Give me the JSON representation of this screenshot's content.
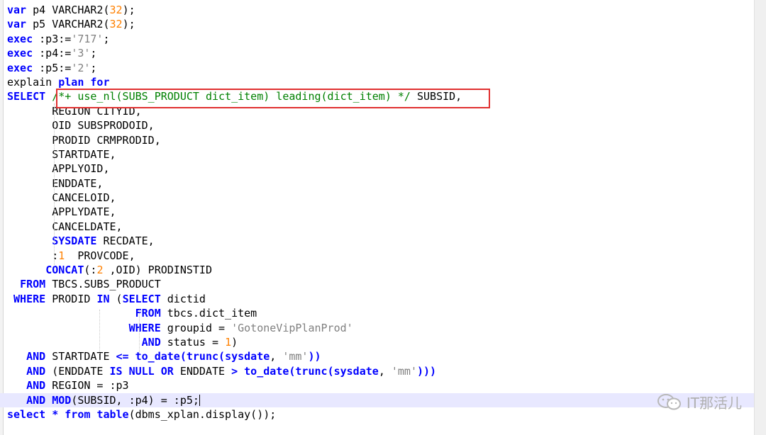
{
  "code_lines": [
    [
      {
        "t": "var",
        "c": "kw"
      },
      {
        "t": " p4 ",
        "c": "plain"
      },
      {
        "t": "VARCHAR2",
        "c": "plain"
      },
      {
        "t": "(",
        "c": "plain"
      },
      {
        "t": "32",
        "c": "num"
      },
      {
        "t": ");",
        "c": "plain"
      }
    ],
    [
      {
        "t": "var",
        "c": "kw"
      },
      {
        "t": " p5 ",
        "c": "plain"
      },
      {
        "t": "VARCHAR2",
        "c": "plain"
      },
      {
        "t": "(",
        "c": "plain"
      },
      {
        "t": "32",
        "c": "num"
      },
      {
        "t": ");",
        "c": "plain"
      }
    ],
    [
      {
        "t": "exec",
        "c": "kw"
      },
      {
        "t": " :p3:=",
        "c": "plain"
      },
      {
        "t": "'717'",
        "c": "str"
      },
      {
        "t": ";",
        "c": "plain"
      }
    ],
    [
      {
        "t": "exec",
        "c": "kw"
      },
      {
        "t": " :p4:=",
        "c": "plain"
      },
      {
        "t": "'3'",
        "c": "str"
      },
      {
        "t": ";",
        "c": "plain"
      }
    ],
    [
      {
        "t": "exec",
        "c": "kw"
      },
      {
        "t": " :p5:=",
        "c": "plain"
      },
      {
        "t": "'2'",
        "c": "str"
      },
      {
        "t": ";",
        "c": "plain"
      }
    ],
    [
      {
        "t": "explain ",
        "c": "plain"
      },
      {
        "t": "plan for",
        "c": "kw"
      }
    ],
    [
      {
        "t": "SELECT",
        "c": "kw"
      },
      {
        "t": " ",
        "c": "plain"
      },
      {
        "t": "/*+ use_nl(SUBS_PRODUCT dict_item) leading(dict_item) */",
        "c": "cmt"
      },
      {
        "t": " SUBSID,",
        "c": "plain"
      }
    ],
    [
      {
        "t": "       REGION CITYID,",
        "c": "plain"
      }
    ],
    [
      {
        "t": "       OID SUBSPRODOID,",
        "c": "plain"
      }
    ],
    [
      {
        "t": "       PRODID CRMPRODID,",
        "c": "plain"
      }
    ],
    [
      {
        "t": "       STARTDATE,",
        "c": "plain"
      }
    ],
    [
      {
        "t": "       APPLYOID,",
        "c": "plain"
      }
    ],
    [
      {
        "t": "       ENDDATE,",
        "c": "plain"
      }
    ],
    [
      {
        "t": "       CANCELOID,",
        "c": "plain"
      }
    ],
    [
      {
        "t": "       APPLYDATE,",
        "c": "plain"
      }
    ],
    [
      {
        "t": "       CANCELDATE,",
        "c": "plain"
      }
    ],
    [
      {
        "t": "       ",
        "c": "plain"
      },
      {
        "t": "SYSDATE",
        "c": "kw"
      },
      {
        "t": " RECDATE,",
        "c": "plain"
      }
    ],
    [
      {
        "t": "       :",
        "c": "plain"
      },
      {
        "t": "1",
        "c": "num"
      },
      {
        "t": "  PROVCODE,",
        "c": "plain"
      }
    ],
    [
      {
        "t": "      ",
        "c": "plain"
      },
      {
        "t": "CONCAT",
        "c": "kw"
      },
      {
        "t": "(:",
        "c": "plain"
      },
      {
        "t": "2",
        "c": "num"
      },
      {
        "t": " ,OID) PRODINSTID",
        "c": "plain"
      }
    ],
    [
      {
        "t": "  ",
        "c": "plain"
      },
      {
        "t": "FROM",
        "c": "kw"
      },
      {
        "t": " TBCS.SUBS_PRODUCT",
        "c": "plain"
      }
    ],
    [
      {
        "t": " ",
        "c": "plain"
      },
      {
        "t": "WHERE",
        "c": "kw"
      },
      {
        "t": " PRODID ",
        "c": "plain"
      },
      {
        "t": "IN",
        "c": "kw"
      },
      {
        "t": " (",
        "c": "plain"
      },
      {
        "t": "SELECT",
        "c": "kw"
      },
      {
        "t": " dictid",
        "c": "plain"
      }
    ],
    [
      {
        "t": "                    ",
        "c": "plain"
      },
      {
        "t": "FROM",
        "c": "kw"
      },
      {
        "t": " tbcs.dict_item",
        "c": "plain"
      }
    ],
    [
      {
        "t": "                   ",
        "c": "plain"
      },
      {
        "t": "WHERE",
        "c": "kw"
      },
      {
        "t": " groupid = ",
        "c": "plain"
      },
      {
        "t": "'GotoneVipPlanProd'",
        "c": "str"
      }
    ],
    [
      {
        "t": "                     ",
        "c": "plain"
      },
      {
        "t": "AND",
        "c": "kw"
      },
      {
        "t": " status = ",
        "c": "plain"
      },
      {
        "t": "1",
        "c": "num"
      },
      {
        "t": ")",
        "c": "plain"
      }
    ],
    [
      {
        "t": "   ",
        "c": "plain"
      },
      {
        "t": "AND",
        "c": "kw"
      },
      {
        "t": " STARTDATE ",
        "c": "plain"
      },
      {
        "t": "<=",
        "c": "kw"
      },
      {
        "t": " ",
        "c": "plain"
      },
      {
        "t": "to_date",
        "c": "kw"
      },
      {
        "t": "(",
        "c": "kw"
      },
      {
        "t": "trunc",
        "c": "kw"
      },
      {
        "t": "(",
        "c": "kw"
      },
      {
        "t": "sysdate",
        "c": "kw"
      },
      {
        "t": ", ",
        "c": "plain"
      },
      {
        "t": "'mm'",
        "c": "str"
      },
      {
        "t": "))",
        "c": "kw"
      }
    ],
    [
      {
        "t": "   ",
        "c": "plain"
      },
      {
        "t": "AND",
        "c": "kw"
      },
      {
        "t": " (ENDDATE ",
        "c": "plain"
      },
      {
        "t": "IS NULL OR",
        "c": "kw"
      },
      {
        "t": " ENDDATE ",
        "c": "plain"
      },
      {
        "t": ">",
        "c": "kw"
      },
      {
        "t": " ",
        "c": "plain"
      },
      {
        "t": "to_date",
        "c": "kw"
      },
      {
        "t": "(",
        "c": "kw"
      },
      {
        "t": "trunc",
        "c": "kw"
      },
      {
        "t": "(",
        "c": "kw"
      },
      {
        "t": "sysdate",
        "c": "kw"
      },
      {
        "t": ", ",
        "c": "plain"
      },
      {
        "t": "'mm'",
        "c": "str"
      },
      {
        "t": ")))",
        "c": "kw"
      }
    ],
    [
      {
        "t": "   ",
        "c": "plain"
      },
      {
        "t": "AND",
        "c": "kw"
      },
      {
        "t": " REGION = :p3",
        "c": "plain"
      }
    ],
    [
      {
        "t": "   ",
        "c": "plain"
      },
      {
        "t": "AND",
        "c": "kw"
      },
      {
        "t": " ",
        "c": "plain"
      },
      {
        "t": "MOD",
        "c": "kw"
      },
      {
        "t": "(SUBSID, :p4) = :p5;",
        "c": "plain"
      }
    ],
    [
      {
        "t": "select",
        "c": "kw"
      },
      {
        "t": " ",
        "c": "plain"
      },
      {
        "t": "*",
        "c": "kw"
      },
      {
        "t": " ",
        "c": "plain"
      },
      {
        "t": "from",
        "c": "kw"
      },
      {
        "t": " ",
        "c": "plain"
      },
      {
        "t": "table",
        "c": "kw"
      },
      {
        "t": "(dbms_xplan.display());",
        "c": "plain"
      }
    ]
  ],
  "current_line_index": 27,
  "watermark": {
    "text": "IT那活儿",
    "icon": "wechat-icon"
  },
  "colors": {
    "keyword": "#0000ff",
    "string": "#808080",
    "number": "#ff8000",
    "comment": "#008000",
    "highlight_box": "#e03030"
  }
}
